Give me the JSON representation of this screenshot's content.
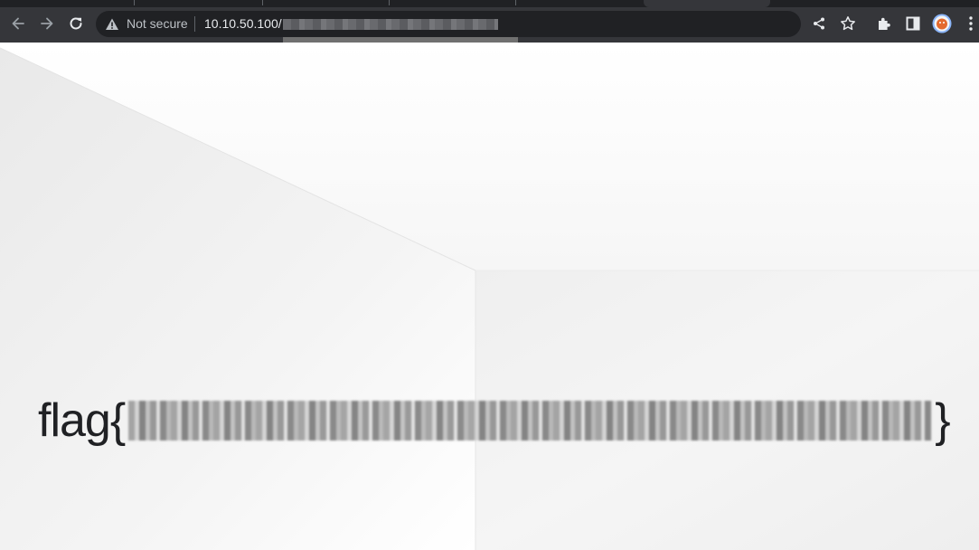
{
  "browser": {
    "security_label": "Not secure",
    "url_host": "10.10.50.100/",
    "icons": {
      "back": "arrow-left-icon",
      "forward": "arrow-right-icon",
      "reload": "reload-icon",
      "security": "warning-triangle-icon",
      "share": "share-icon",
      "bookmark": "star-icon",
      "extensions": "puzzle-icon",
      "side_panel": "side-panel-icon",
      "profile": "avatar",
      "menu": "kebab-menu-icon"
    },
    "colors": {
      "toolbar": "#35363a",
      "omnibox": "#202124",
      "tabstrip": "#202124"
    }
  },
  "page": {
    "flag_prefix": "flag{",
    "flag_suffix": "}"
  }
}
